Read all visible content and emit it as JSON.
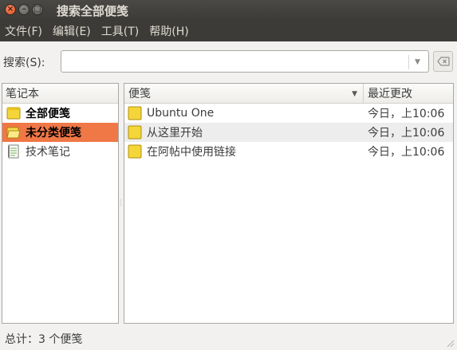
{
  "window": {
    "title": "搜索全部便笺",
    "close_glyph": "×",
    "min_glyph": "–",
    "max_glyph": "□"
  },
  "menubar": {
    "items": [
      "文件(F)",
      "编辑(E)",
      "工具(T)",
      "帮助(H)"
    ]
  },
  "search": {
    "label": "搜索(S):",
    "value": "",
    "placeholder": ""
  },
  "notebooks": {
    "header": "笔记本",
    "items": [
      {
        "label": "全部便笺",
        "icon": "folder-notes-icon",
        "selected": false
      },
      {
        "label": "未分类便笺",
        "icon": "open-folder-icon",
        "selected": true
      },
      {
        "label": "技术笔记",
        "icon": "notebook-icon",
        "selected": false
      }
    ]
  },
  "notes": {
    "columns": {
      "title": "便笺",
      "date": "最近更改"
    },
    "rows": [
      {
        "title": "Ubuntu One",
        "date": "今日，上10:06"
      },
      {
        "title": "从这里开始",
        "date": "今日，上10:06"
      },
      {
        "title": "在阿帖中使用链接",
        "date": "今日，上10:06"
      }
    ]
  },
  "status": {
    "text": "总计：3 个便笺"
  },
  "colors": {
    "selection": "#f07746",
    "titlebar": "#3c3b37",
    "close": "#df4a17"
  }
}
